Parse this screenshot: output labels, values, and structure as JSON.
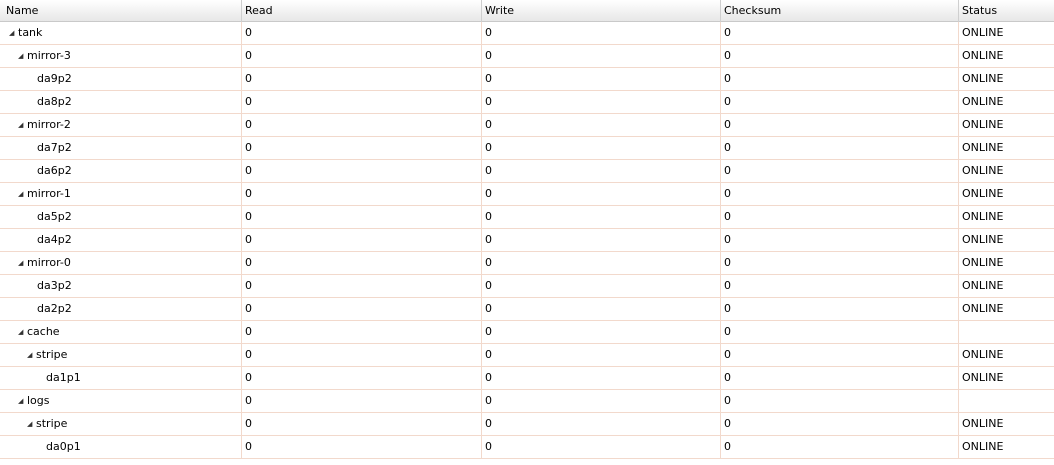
{
  "columns": {
    "name": "Name",
    "read": "Read",
    "write": "Write",
    "checksum": "Checksum",
    "status": "Status"
  },
  "rows": [
    {
      "name": "tank",
      "read": "0",
      "write": "0",
      "checksum": "0",
      "status": "ONLINE"
    },
    {
      "name": "mirror-3",
      "read": "0",
      "write": "0",
      "checksum": "0",
      "status": "ONLINE"
    },
    {
      "name": "da9p2",
      "read": "0",
      "write": "0",
      "checksum": "0",
      "status": "ONLINE"
    },
    {
      "name": "da8p2",
      "read": "0",
      "write": "0",
      "checksum": "0",
      "status": "ONLINE"
    },
    {
      "name": "mirror-2",
      "read": "0",
      "write": "0",
      "checksum": "0",
      "status": "ONLINE"
    },
    {
      "name": "da7p2",
      "read": "0",
      "write": "0",
      "checksum": "0",
      "status": "ONLINE"
    },
    {
      "name": "da6p2",
      "read": "0",
      "write": "0",
      "checksum": "0",
      "status": "ONLINE"
    },
    {
      "name": "mirror-1",
      "read": "0",
      "write": "0",
      "checksum": "0",
      "status": "ONLINE"
    },
    {
      "name": "da5p2",
      "read": "0",
      "write": "0",
      "checksum": "0",
      "status": "ONLINE"
    },
    {
      "name": "da4p2",
      "read": "0",
      "write": "0",
      "checksum": "0",
      "status": "ONLINE"
    },
    {
      "name": "mirror-0",
      "read": "0",
      "write": "0",
      "checksum": "0",
      "status": "ONLINE"
    },
    {
      "name": "da3p2",
      "read": "0",
      "write": "0",
      "checksum": "0",
      "status": "ONLINE"
    },
    {
      "name": "da2p2",
      "read": "0",
      "write": "0",
      "checksum": "0",
      "status": "ONLINE"
    },
    {
      "name": "cache",
      "read": "0",
      "write": "0",
      "checksum": "0",
      "status": ""
    },
    {
      "name": "stripe",
      "read": "0",
      "write": "0",
      "checksum": "0",
      "status": "ONLINE"
    },
    {
      "name": "da1p1",
      "read": "0",
      "write": "0",
      "checksum": "0",
      "status": "ONLINE"
    },
    {
      "name": "logs",
      "read": "0",
      "write": "0",
      "checksum": "0",
      "status": ""
    },
    {
      "name": "stripe",
      "read": "0",
      "write": "0",
      "checksum": "0",
      "status": "ONLINE"
    },
    {
      "name": "da0p1",
      "read": "0",
      "write": "0",
      "checksum": "0",
      "status": "ONLINE"
    }
  ],
  "icons": {
    "expander": "expanded-triangle-icon"
  },
  "colors": {
    "row_border": "#f2d9cc",
    "header_bg": "#e7e7e7"
  }
}
